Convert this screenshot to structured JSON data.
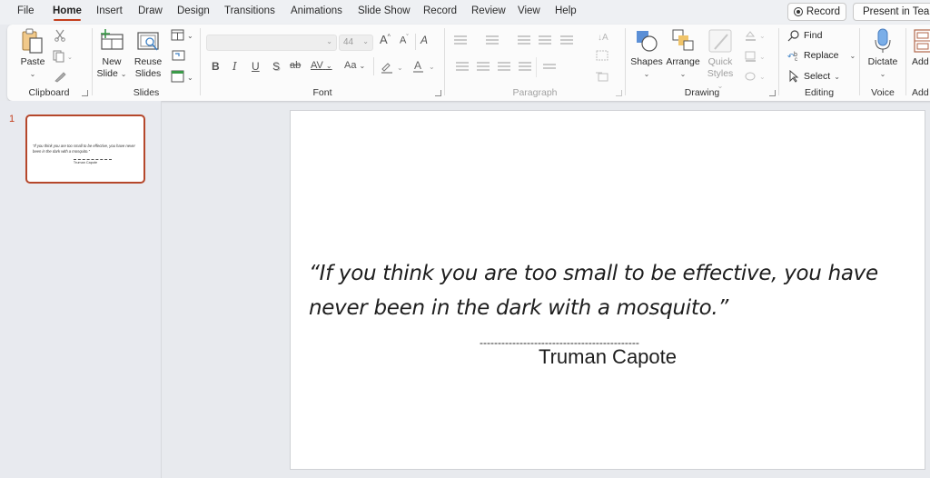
{
  "menu": {
    "tabs": [
      "File",
      "Home",
      "Insert",
      "Draw",
      "Design",
      "Transitions",
      "Animations",
      "Slide Show",
      "Record",
      "Review",
      "View",
      "Help"
    ],
    "active_tab": "Home",
    "record_button": "Record",
    "present_button": "Present in Teams"
  },
  "ribbon": {
    "clipboard": {
      "label": "Clipboard",
      "paste": "Paste"
    },
    "slides": {
      "label": "Slides",
      "new_slide_line1": "New",
      "new_slide_line2": "Slide",
      "reuse_line1": "Reuse",
      "reuse_line2": "Slides"
    },
    "font": {
      "label": "Font",
      "font_name": "",
      "font_size": "44",
      "bold": "B",
      "italic": "I",
      "underline": "U",
      "shadow": "S",
      "strike": "ab",
      "spacing": "AV",
      "case": "Aa",
      "grow": "A",
      "shrink": "A"
    },
    "paragraph": {
      "label": "Paragraph"
    },
    "drawing": {
      "label": "Drawing",
      "shapes": "Shapes",
      "arrange": "Arrange",
      "quick_styles_line1": "Quick",
      "quick_styles_line2": "Styles"
    },
    "editing": {
      "label": "Editing",
      "find": "Find",
      "replace": "Replace",
      "select": "Select"
    },
    "voice": {
      "label": "Voice",
      "dictate": "Dictate"
    },
    "addins": {
      "label": "Add",
      "button": "Add"
    }
  },
  "thumbnails": [
    {
      "number": "1",
      "quote": "“If you think you are too small to be effective, you have never been in the dark with a mosquito.”",
      "author": "Truman Capote"
    }
  ],
  "slide": {
    "quote": "“If you think you are too small to be effective, you have never been in the dark with a mosquito.”",
    "separator": "--------------------------------------------",
    "author": "Truman Capote"
  },
  "colors": {
    "accent": "#c43e1c",
    "thumbnail_border": "#b5472b"
  }
}
